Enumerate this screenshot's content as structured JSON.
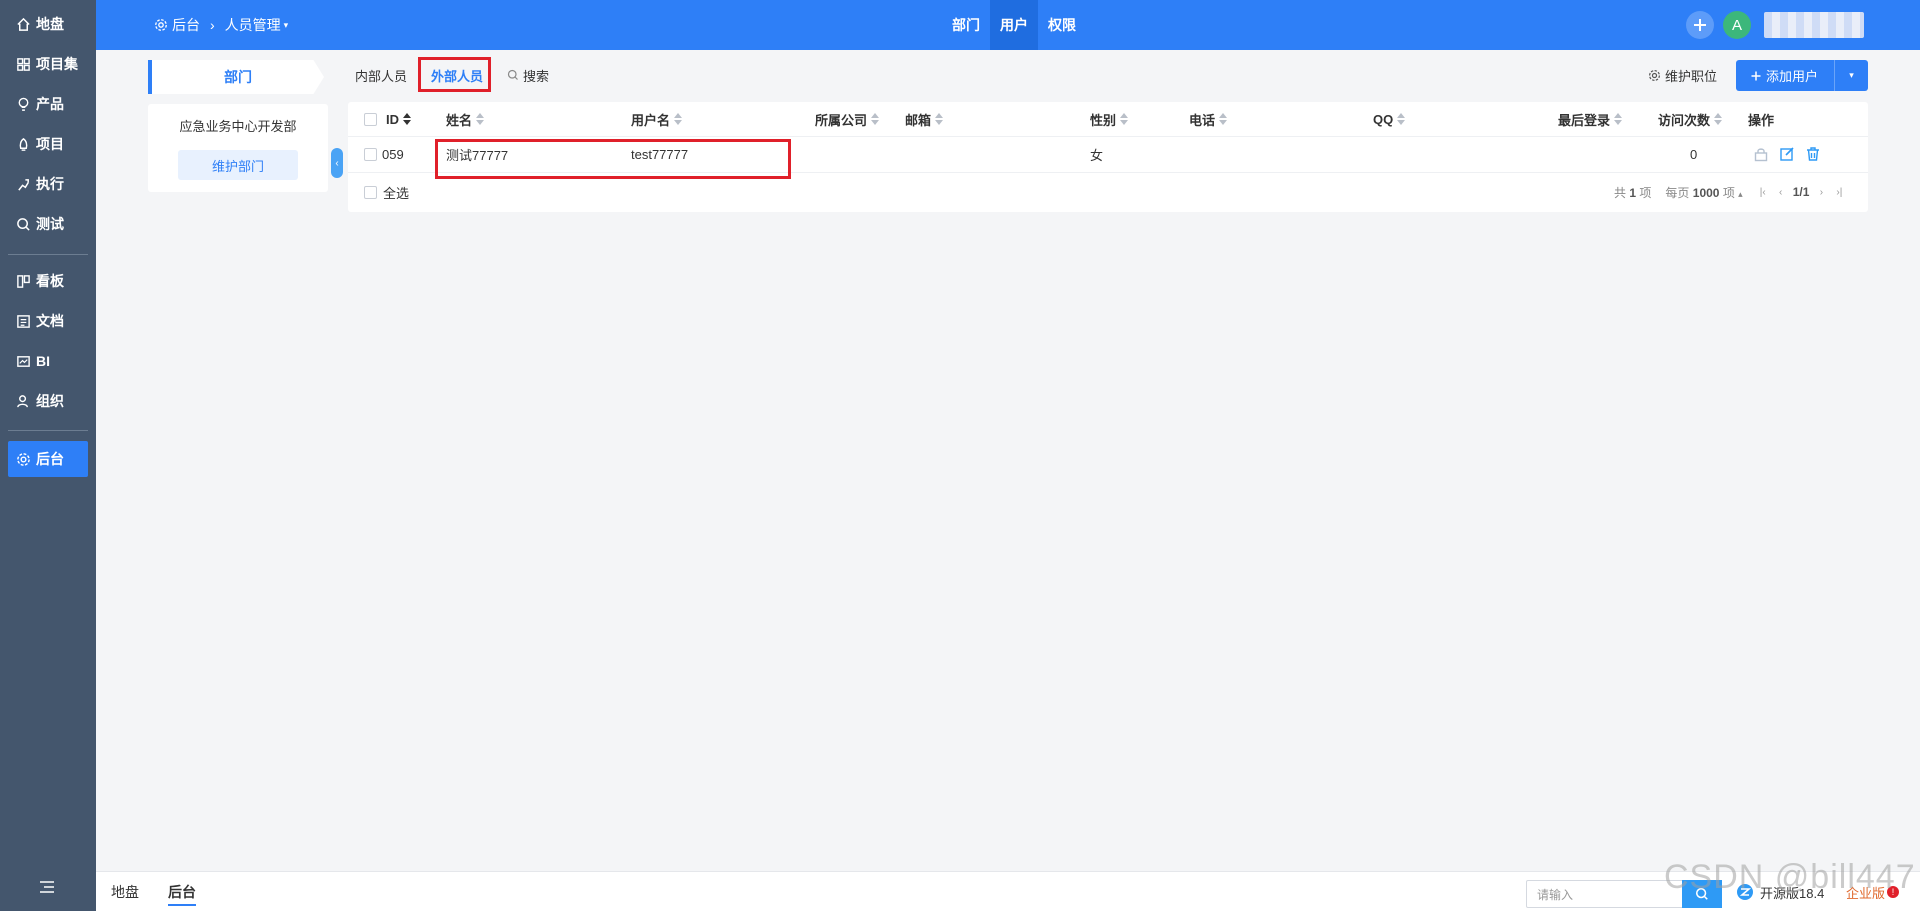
{
  "sidebar": {
    "items": [
      {
        "label": "地盘",
        "icon": "home-icon"
      },
      {
        "label": "项目集",
        "icon": "grid-icon"
      },
      {
        "label": "产品",
        "icon": "lightbulb-icon"
      },
      {
        "label": "项目",
        "icon": "flag-icon"
      },
      {
        "label": "执行",
        "icon": "run-icon"
      },
      {
        "label": "测试",
        "icon": "magnifier-icon"
      },
      {
        "label": "看板",
        "icon": "kanban-icon"
      },
      {
        "label": "文档",
        "icon": "doc-icon"
      },
      {
        "label": "BI",
        "icon": "chart-icon"
      },
      {
        "label": "组织",
        "icon": "people-icon"
      },
      {
        "label": "后台",
        "icon": "gear-icon",
        "active": true
      }
    ]
  },
  "header": {
    "breadcrumb_root": "后台",
    "breadcrumb_current": "人员管理",
    "nav": [
      "部门",
      "用户",
      "权限"
    ],
    "active_nav": "用户",
    "avatar_letter": "A"
  },
  "dept": {
    "tab_label": "部门",
    "dept_name": "应急业务中心开发部",
    "maintain_label": "维护部门"
  },
  "toolbar": {
    "tab_internal": "内部人员",
    "tab_external": "外部人员",
    "search_label": "搜索",
    "maintain_position": "维护职位",
    "add_user": "添加用户"
  },
  "table": {
    "columns": [
      "ID",
      "姓名",
      "用户名",
      "所属公司",
      "邮箱",
      "性别",
      "电话",
      "QQ",
      "最后登录",
      "访问次数",
      "操作"
    ],
    "rows": [
      {
        "id": "059",
        "name": "测试77777",
        "username": "test77777",
        "company": "",
        "email": "",
        "gender": "女",
        "phone": "",
        "qq": "",
        "last_login": "",
        "visits": "0"
      }
    ],
    "select_all": "全选"
  },
  "pager": {
    "total_prefix": "共",
    "total": "1",
    "total_suffix": "项",
    "per_page_prefix": "每页",
    "per_page": "1000",
    "per_page_suffix": "项",
    "page": "1/1"
  },
  "bottombar": {
    "home": "地盘",
    "admin": "后台",
    "search_placeholder": "请输入",
    "version": "开源版18.4",
    "enterprise": "企业版"
  },
  "watermark": "CSDN @bill447",
  "colors": {
    "primary": "#2e7ff7",
    "sidebar": "#44566d",
    "highlight_border": "#e0202a"
  }
}
